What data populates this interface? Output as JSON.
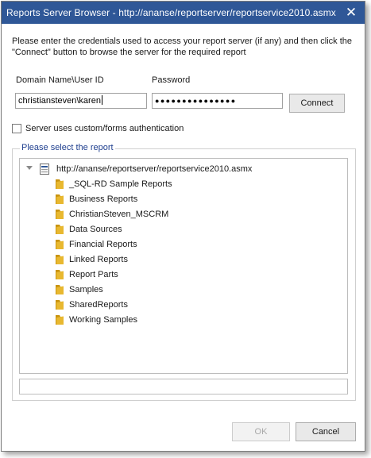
{
  "window": {
    "title": "Reports Server Browser - http://ananse/reportserver/reportservice2010.asmx",
    "close_symbol": "✕"
  },
  "instructions": "Please enter the credentials used to access your report server (if any) and then click the \"Connect\" button to browse the server for the required report",
  "credentials": {
    "user_label": "Domain Name\\User ID",
    "user_value": "christiansteven\\karen",
    "password_label": "Password",
    "password_value": "●●●●●●●●●●●●●●●",
    "connect_label": "Connect"
  },
  "custom_auth": {
    "label": "Server uses custom/forms authentication",
    "checked": false
  },
  "report_group": {
    "title": "Please select the report",
    "root": "http://ananse/reportserver/reportservice2010.asmx",
    "folders": [
      "_SQL-RD Sample Reports",
      "Business Reports",
      "ChristianSteven_MSCRM",
      "Data Sources",
      "Financial Reports",
      "Linked Reports",
      "Report Parts",
      "Samples",
      "SharedReports",
      "Working Samples"
    ],
    "selected_path": ""
  },
  "footer": {
    "ok_label": "OK",
    "cancel_label": "Cancel",
    "ok_enabled": false
  },
  "colors": {
    "titlebar": "#2f5797",
    "group_title": "#1f3f8f",
    "folder": "#e8b830"
  },
  "icons": {
    "close": "close-icon",
    "expander": "collapse-triangle-icon",
    "server": "report-server-icon",
    "folder": "folder-icon"
  }
}
